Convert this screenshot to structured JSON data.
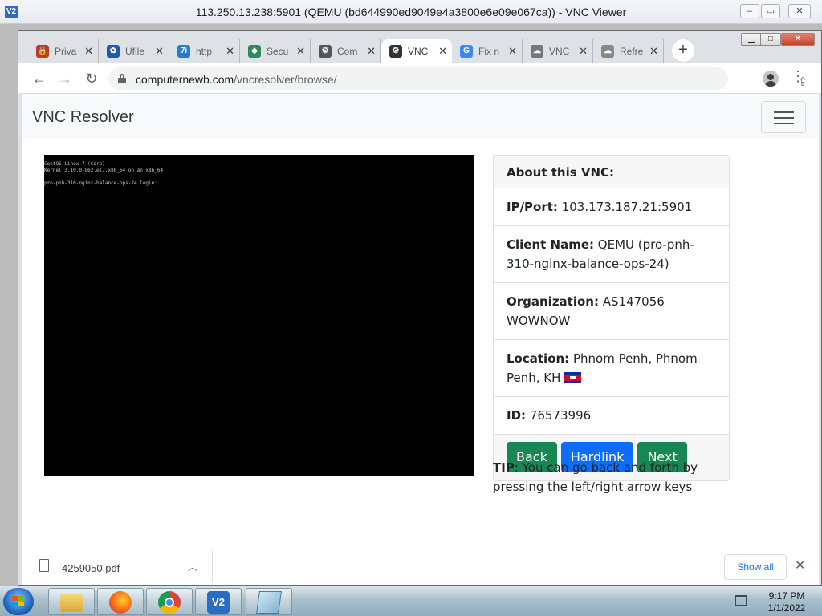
{
  "vnc_viewer": {
    "app_icon": "V2",
    "title": "113.250.13.238:5901 (QEMU (bd644990ed9049e4a3800e6e09e067ca)) - VNC Viewer",
    "controls": [
      "minimize-icon",
      "maximize-icon",
      "close-icon"
    ]
  },
  "browser": {
    "tabs": [
      {
        "label": "Priva",
        "icon": "lock-site-icon",
        "icon_color": "#c0392b",
        "icon_text": "🔒",
        "active": false
      },
      {
        "label": "Ufile",
        "icon": "ufile-icon",
        "icon_color": "#1e5aa8",
        "icon_text": "✿",
        "active": false
      },
      {
        "label": "http",
        "icon": "seven-i-icon",
        "icon_color": "#2a7ac7",
        "icon_text": "7i",
        "active": false
      },
      {
        "label": "Secu",
        "icon": "shield-icon",
        "icon_color": "#2e8b57",
        "icon_text": "◆",
        "active": false
      },
      {
        "label": "Com",
        "icon": "vnc-resolver-icon",
        "icon_color": "#555555",
        "icon_text": "⚙",
        "active": false
      },
      {
        "label": "VNC",
        "icon": "vnc-resolver-icon",
        "icon_color": "#333333",
        "icon_text": "⚙",
        "active": true
      },
      {
        "label": "Fix n",
        "icon": "google-icon",
        "icon_color": "#4285f4",
        "icon_text": "G",
        "active": false
      },
      {
        "label": "VNC",
        "icon": "cloud-icon",
        "icon_color": "#777777",
        "icon_text": "☁",
        "active": false
      },
      {
        "label": "Refre",
        "icon": "cloud-icon",
        "icon_color": "#888888",
        "icon_text": "☁",
        "active": false
      }
    ],
    "new_tab": "+",
    "url_host": "computernewb.com",
    "url_path": "/vncresolver/browse/"
  },
  "page": {
    "brand": "VNC Resolver",
    "terminal_lines": [
      "CentOS Linux 7 (Core)",
      "Kernel 3.10.0-862.el7.x86_64 on an x86_64",
      "",
      "pro-pnh-310-nginx-balance-ops-24 login:"
    ],
    "card": {
      "header": "About this VNC:",
      "ip_label": "IP/Port:",
      "ip_value": "103.173.187.21:5901",
      "client_label": "Client Name:",
      "client_value": "QEMU (pro-pnh-310-nginx-balance-ops-24)",
      "org_label": "Organization:",
      "org_value": "AS147056 WOWNOW",
      "location_label": "Location:",
      "location_value": "Phnom Penh, Phnom Penh, KH",
      "id_label": "ID:",
      "id_value": "76573996",
      "buttons": {
        "back": "Back",
        "hardlink": "Hardlink",
        "next": "Next"
      }
    },
    "tip_label": "TIP",
    "tip_text": ": You can go back and forth by pressing the left/right arrow keys"
  },
  "download_shelf": {
    "filename": "4259050.pdf",
    "show_all": "Show all"
  },
  "taskbar": {
    "apps": [
      "explorer-icon",
      "firefox-icon",
      "chrome-icon",
      "vnc-viewer-icon",
      "notepad-icon"
    ],
    "time": "9:17 PM",
    "date": "1/1/2022"
  },
  "colors": {
    "btn_green": "#198754",
    "btn_blue": "#0d6efd",
    "navbar_bg": "#f8f9fa"
  }
}
